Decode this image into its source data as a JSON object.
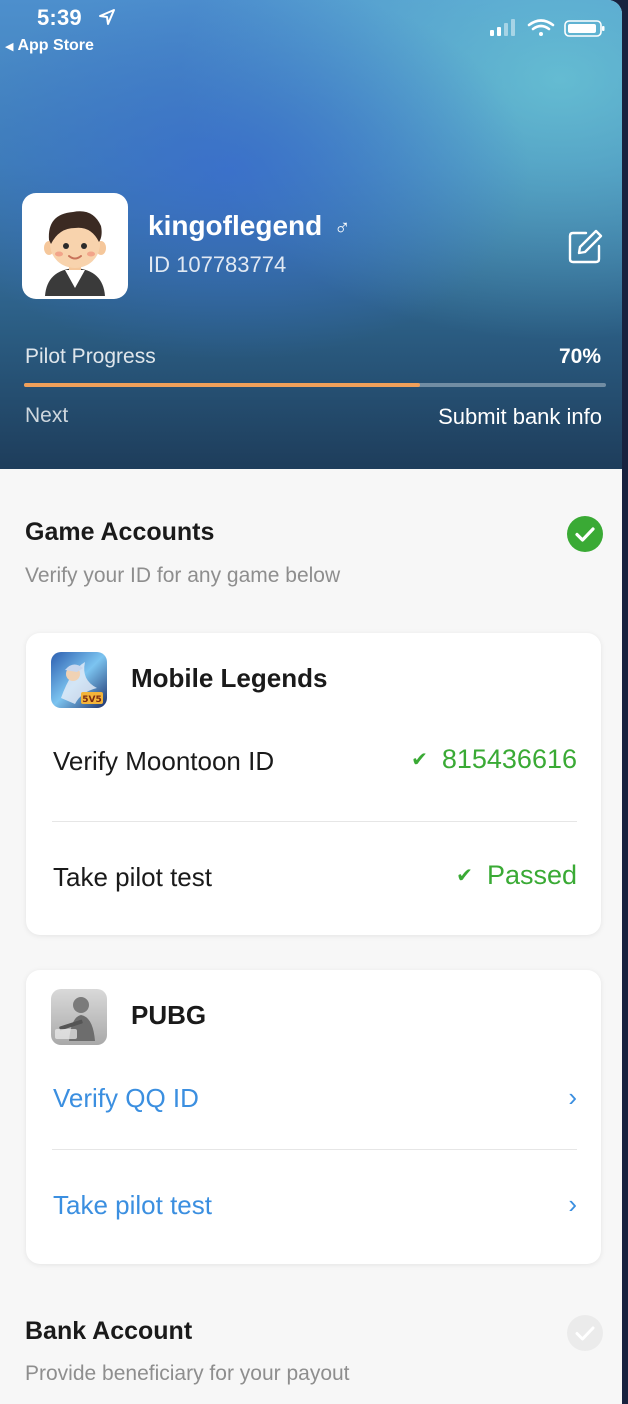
{
  "status_bar": {
    "time": "5:39",
    "back_app": "App Store"
  },
  "profile": {
    "username": "kingoflegend",
    "gender_symbol": "♂",
    "id_text": "ID 107783774"
  },
  "progress": {
    "label": "Pilot Progress",
    "value_text": "70%",
    "fraction": 0.68,
    "next_label": "Next",
    "next_value": "Submit bank info",
    "fill_color": "#f0a05a"
  },
  "game_accounts": {
    "title": "Game Accounts",
    "subtitle": "Verify your ID for any game below",
    "complete": true,
    "games": [
      {
        "name": "Mobile Legends",
        "icon": "mobile-legends-icon",
        "rows": [
          {
            "label": "Verify Moontoon ID",
            "value": "815436616"
          },
          {
            "label": "Take pilot test",
            "value": "Passed"
          }
        ]
      },
      {
        "name": "PUBG",
        "icon": "pubg-icon",
        "rows": [
          {
            "label": "Verify QQ ID"
          },
          {
            "label": "Take pilot test"
          }
        ]
      }
    ]
  },
  "bank_account": {
    "title": "Bank Account",
    "subtitle": "Provide beneficiary for your payout",
    "complete": false
  },
  "colors": {
    "success": "#3aaa35",
    "link": "#3b8fe0",
    "accent": "#f0a05a"
  }
}
